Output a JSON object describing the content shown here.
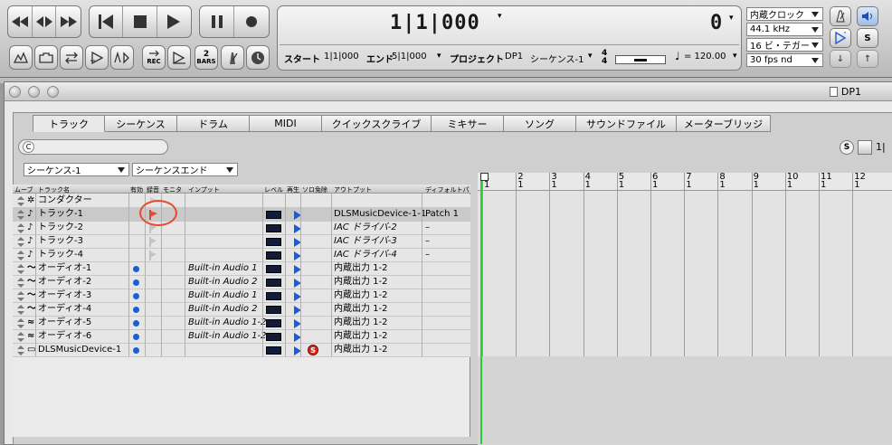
{
  "transport": {
    "buttons": [
      "rewind",
      "fast-forward-toggle",
      "fast-forward",
      "go-to-start",
      "stop",
      "play",
      "pause",
      "record"
    ],
    "small_buttons": [
      "punch-in",
      "punch-out",
      "loop",
      "overdub",
      "auto-record",
      "rec-mode",
      "count-off",
      "bars",
      "metronome",
      "clock"
    ],
    "rec_label": "REC",
    "bars_num": "2",
    "bars_label": "BARS",
    "counter_main": "1|1|000",
    "counter_secondary": "0",
    "start_label": "スタート",
    "start_value": "1|1|000",
    "end_label": "エンド",
    "end_value": "5|1|000",
    "project_label": "プロジェクト",
    "project_value": "DP1",
    "sequence_value": "シーケンス-1",
    "meter_top": "4",
    "meter_bottom": "4",
    "tempo_value": "= 120.00",
    "clock_source": "内蔵クロック",
    "sample_rate": "44.1 kHz",
    "bit_depth": "16 ビ・テガー",
    "frame_rate": "30 fps nd",
    "right_s": "S"
  },
  "window": {
    "title": "DP1",
    "tabs": [
      {
        "label": "トラック",
        "selected": true
      },
      {
        "label": "シーケンス",
        "selected": false
      },
      {
        "label": "ドラム",
        "selected": false
      },
      {
        "label": "MIDI",
        "selected": false
      },
      {
        "label": "クイックスクライブ",
        "selected": false
      },
      {
        "label": "ミキサー",
        "selected": false
      },
      {
        "label": "ソング",
        "selected": false
      },
      {
        "label": "サウンドファイル",
        "selected": false
      },
      {
        "label": "メーターブリッジ",
        "selected": false
      }
    ],
    "search_placeholder": "C",
    "nav_s": "S",
    "nav_num": "1|",
    "sequence_select": "シーケンス-1",
    "sequence_end_select": "シーケンスエンド"
  },
  "tracklist": {
    "headers": {
      "move": "ムーブ",
      "name": "トラック名",
      "enable": "有効",
      "record": "録音",
      "monitor": "モニタ",
      "input": "インプット",
      "level": "レベル",
      "play": "再生",
      "solo": "ソロ免除",
      "output": "アウトプット",
      "default": "ディフォルトパ"
    },
    "rows": [
      {
        "name": "コンダクター",
        "icon": "conductor-icon",
        "enabled": false,
        "rec": "none",
        "input": "",
        "level": false,
        "play": false,
        "solo": false,
        "output": "",
        "output_italic": false,
        "patch": ""
      },
      {
        "name": "トラック-1",
        "icon": "midi-note-icon",
        "enabled": false,
        "rec": "armed",
        "input": "",
        "level": true,
        "play": true,
        "solo": false,
        "output": "DLSMusicDevice-1-1",
        "output_italic": false,
        "patch": "Patch 1"
      },
      {
        "name": "トラック-2",
        "icon": "midi-note-icon",
        "enabled": false,
        "rec": "off",
        "input": "",
        "level": true,
        "play": true,
        "solo": false,
        "output": "IAC ドライバ-2",
        "output_italic": true,
        "patch": "–"
      },
      {
        "name": "トラック-3",
        "icon": "midi-note-icon",
        "enabled": false,
        "rec": "off",
        "input": "",
        "level": true,
        "play": true,
        "solo": false,
        "output": "IAC ドライバ-3",
        "output_italic": true,
        "patch": "–"
      },
      {
        "name": "トラック-4",
        "icon": "midi-note-icon",
        "enabled": false,
        "rec": "off",
        "input": "",
        "level": true,
        "play": true,
        "solo": false,
        "output": "IAC ドライバ-4",
        "output_italic": true,
        "patch": "–"
      },
      {
        "name": "オーディオ-1",
        "icon": "audio-mono-icon",
        "enabled": true,
        "rec": "none",
        "input": "Built-in Audio 1",
        "level": true,
        "play": true,
        "solo": false,
        "output": "内蔵出力 1-2",
        "output_italic": false,
        "patch": ""
      },
      {
        "name": "オーディオ-2",
        "icon": "audio-mono-icon",
        "enabled": true,
        "rec": "none",
        "input": "Built-in Audio 2",
        "level": true,
        "play": true,
        "solo": false,
        "output": "内蔵出力 1-2",
        "output_italic": false,
        "patch": ""
      },
      {
        "name": "オーディオ-3",
        "icon": "audio-mono-icon",
        "enabled": true,
        "rec": "none",
        "input": "Built-in Audio 1",
        "level": true,
        "play": true,
        "solo": false,
        "output": "内蔵出力 1-2",
        "output_italic": false,
        "patch": ""
      },
      {
        "name": "オーディオ-4",
        "icon": "audio-mono-icon",
        "enabled": true,
        "rec": "none",
        "input": "Built-in Audio 2",
        "level": true,
        "play": true,
        "solo": false,
        "output": "内蔵出力 1-2",
        "output_italic": false,
        "patch": ""
      },
      {
        "name": "オーディオ-5",
        "icon": "audio-stereo-icon",
        "enabled": true,
        "rec": "none",
        "input": "Built-in Audio 1-2",
        "level": true,
        "play": true,
        "solo": false,
        "output": "内蔵出力 1-2",
        "output_italic": false,
        "patch": ""
      },
      {
        "name": "オーディオ-6",
        "icon": "audio-stereo-icon",
        "enabled": true,
        "rec": "none",
        "input": "Built-in Audio 1-2",
        "level": true,
        "play": true,
        "solo": false,
        "output": "内蔵出力 1-2",
        "output_italic": false,
        "patch": ""
      },
      {
        "name": "DLSMusicDevice-1",
        "icon": "instrument-icon",
        "enabled": true,
        "rec": "none",
        "input": "",
        "level": true,
        "play": true,
        "solo": true,
        "output": "内蔵出力 1-2",
        "output_italic": false,
        "patch": ""
      }
    ],
    "solo_glyph": "S"
  },
  "timeline": {
    "bars": [
      "1",
      "2",
      "3",
      "4",
      "5",
      "6",
      "7",
      "8",
      "9",
      "10",
      "11",
      "12"
    ],
    "beat": "1"
  },
  "colors": {
    "accent_blue": "#1e5bd8",
    "record_red": "#e8492f",
    "playhead_green": "#2ccc3a"
  }
}
